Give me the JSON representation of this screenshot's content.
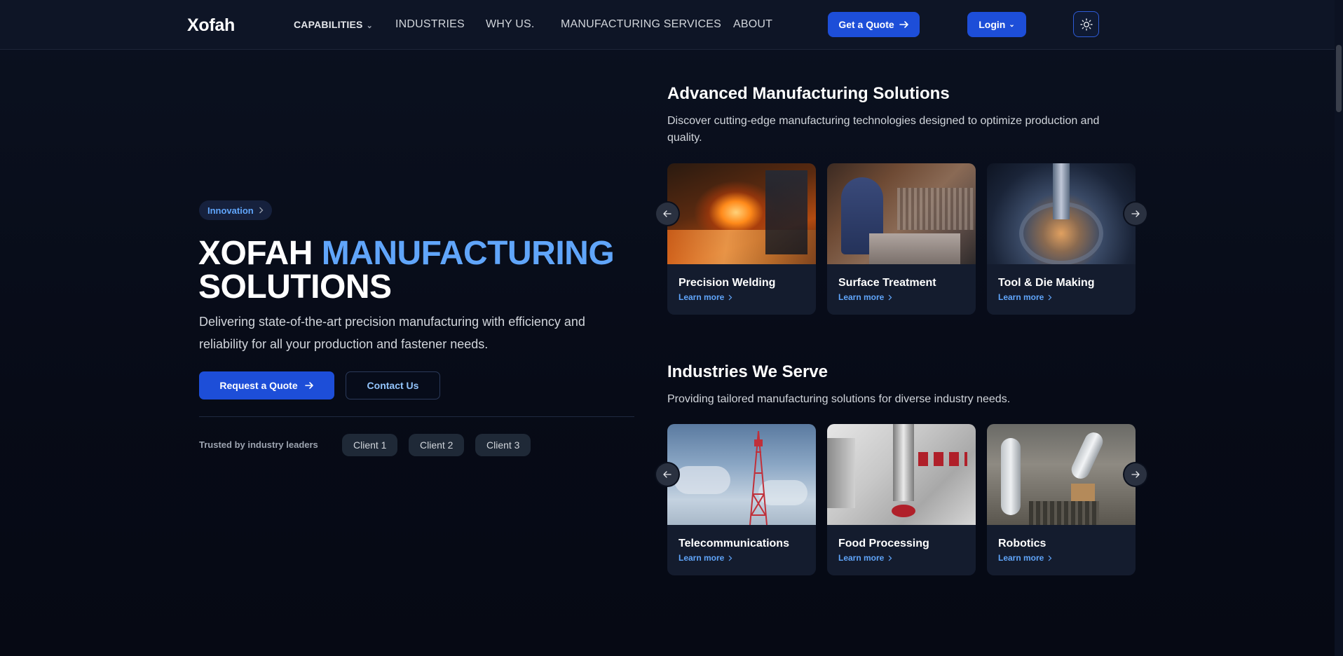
{
  "header": {
    "logo": "Xofah",
    "nav": [
      "CAPABILITIES",
      "INDUSTRIES",
      "WHY US.",
      "MANUFACTURING SERVICES",
      "ABOUT"
    ],
    "quote_button": "Get a Quote",
    "login_button": "Login",
    "theme_icon": "sun-icon"
  },
  "hero": {
    "badge": "Innovation",
    "title_part1": "XOFAH",
    "title_accent": "MANUFACTURING",
    "title_part2": "SOLUTIONS",
    "description": "Delivering state-of-the-art precision manufacturing with efficiency and reliability for all your production and fastener needs.",
    "request_button": "Request a Quote",
    "contact_button": "Contact Us",
    "trusted_label": "Trusted by industry leaders",
    "clients": [
      "Client 1",
      "Client 2",
      "Client 3"
    ]
  },
  "solutions": {
    "title": "Advanced Manufacturing Solutions",
    "description": "Discover cutting-edge manufacturing technologies designed to optimize production and quality.",
    "cards": [
      {
        "title": "Precision Welding",
        "link": "Learn more"
      },
      {
        "title": "Surface Treatment",
        "link": "Learn more"
      },
      {
        "title": "Tool & Die Making",
        "link": "Learn more"
      }
    ]
  },
  "industries": {
    "title": "Industries We Serve",
    "description": "Providing tailored manufacturing solutions for diverse industry needs.",
    "cards": [
      {
        "title": "Telecommunications",
        "link": "Learn more"
      },
      {
        "title": "Food Processing",
        "link": "Learn more"
      },
      {
        "title": "Robotics",
        "link": "Learn more"
      }
    ]
  },
  "colors": {
    "accent": "#1d4ed8",
    "accent_text": "#60a5fa",
    "background": "#070b17"
  }
}
